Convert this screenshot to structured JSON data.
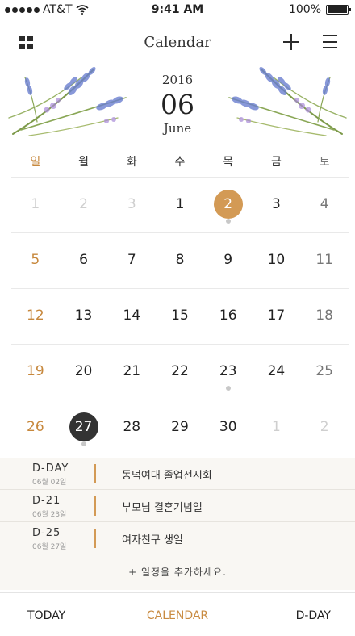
{
  "status": {
    "carrier": "AT&T",
    "time": "9:41 AM",
    "battery": "100%",
    "battery_level": 1.0
  },
  "nav": {
    "title": "Calendar"
  },
  "header": {
    "year": "2016",
    "month_num": "06",
    "month_name": "June"
  },
  "weekdays": [
    "일",
    "월",
    "화",
    "수",
    "목",
    "금",
    "토"
  ],
  "weeks": [
    [
      {
        "n": "1",
        "muted": true
      },
      {
        "n": "2",
        "muted": true
      },
      {
        "n": "3",
        "muted": true
      },
      {
        "n": "1"
      },
      {
        "n": "2",
        "today": true,
        "dot": true
      },
      {
        "n": "3"
      },
      {
        "n": "4"
      }
    ],
    [
      {
        "n": "5"
      },
      {
        "n": "6"
      },
      {
        "n": "7"
      },
      {
        "n": "8"
      },
      {
        "n": "9"
      },
      {
        "n": "10"
      },
      {
        "n": "11"
      }
    ],
    [
      {
        "n": "12"
      },
      {
        "n": "13"
      },
      {
        "n": "14"
      },
      {
        "n": "15"
      },
      {
        "n": "16"
      },
      {
        "n": "17"
      },
      {
        "n": "18"
      }
    ],
    [
      {
        "n": "19"
      },
      {
        "n": "20"
      },
      {
        "n": "21"
      },
      {
        "n": "22"
      },
      {
        "n": "23",
        "dot": true
      },
      {
        "n": "24"
      },
      {
        "n": "25"
      }
    ],
    [
      {
        "n": "26"
      },
      {
        "n": "27",
        "selected": true,
        "dot": true
      },
      {
        "n": "28"
      },
      {
        "n": "29"
      },
      {
        "n": "30"
      },
      {
        "n": "1",
        "muted": true
      },
      {
        "n": "2",
        "muted": true
      }
    ]
  ],
  "events": [
    {
      "dday": "D-DAY",
      "date": "06월 02일",
      "title": "동덕여대 졸업전시회"
    },
    {
      "dday": "D-21",
      "date": "06월 23일",
      "title": "부모님 결혼기념일"
    },
    {
      "dday": "D-25",
      "date": "06월 27일",
      "title": "여자친구 생일"
    }
  ],
  "add_event_label": "+  일정을 추가하세요.",
  "tabs": {
    "today": "TODAY",
    "calendar": "CALENDAR",
    "dday": "D-DAY"
  },
  "colors": {
    "accent": "#c98b41",
    "today_fill": "#d39a55",
    "selected_fill": "#333333",
    "muted": "#cfcfcf"
  }
}
